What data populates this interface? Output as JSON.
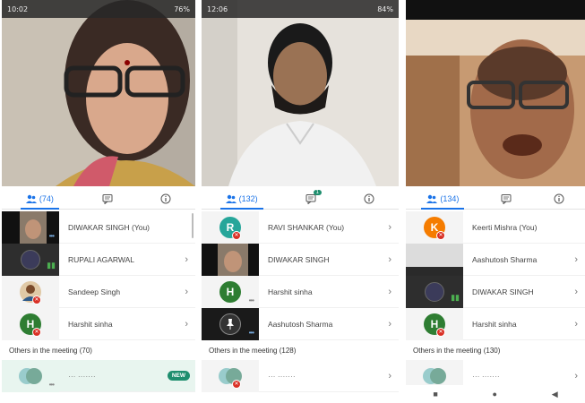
{
  "phones": [
    {
      "status_time": "10:02",
      "status_right": "76%",
      "tabs": {
        "people_count": "(74)"
      },
      "people": [
        {
          "name": "DIWAKAR SINGH (You)"
        },
        {
          "name": "RUPALI AGARWAL"
        },
        {
          "name": "Sandeep Singh"
        },
        {
          "name": "Harshit sinha",
          "initial": "H"
        }
      ],
      "others_label": "Others in the meeting (70)",
      "new_badge": "NEW"
    },
    {
      "status_time": "12:06",
      "status_right": "84%",
      "tabs": {
        "people_count": "(132)",
        "chat_badge": "1"
      },
      "people": [
        {
          "name": "RAVI SHANKAR (You)",
          "initial": "R"
        },
        {
          "name": "DIWAKAR SINGH"
        },
        {
          "name": "Harshit sinha",
          "initial": "H"
        },
        {
          "name": "Aashutosh Sharma"
        }
      ],
      "others_label": "Others in the meeting (128)"
    },
    {
      "tabs": {
        "people_count": "(134)"
      },
      "people": [
        {
          "name": "Keerti Mishra (You)",
          "initial": "K"
        },
        {
          "name": "Aashutosh Sharma"
        },
        {
          "name": "DIWAKAR SINGH"
        },
        {
          "name": "Harshit sinha",
          "initial": "H"
        }
      ],
      "others_label": "Others in the meeting (130)"
    }
  ],
  "colors": {
    "accent": "#1a73e8",
    "avatar_green": "#2e7d32",
    "avatar_teal": "#26a69a",
    "avatar_orange": "#f57c00",
    "badge_red": "#d93025",
    "new_green": "#1e8e6e"
  }
}
